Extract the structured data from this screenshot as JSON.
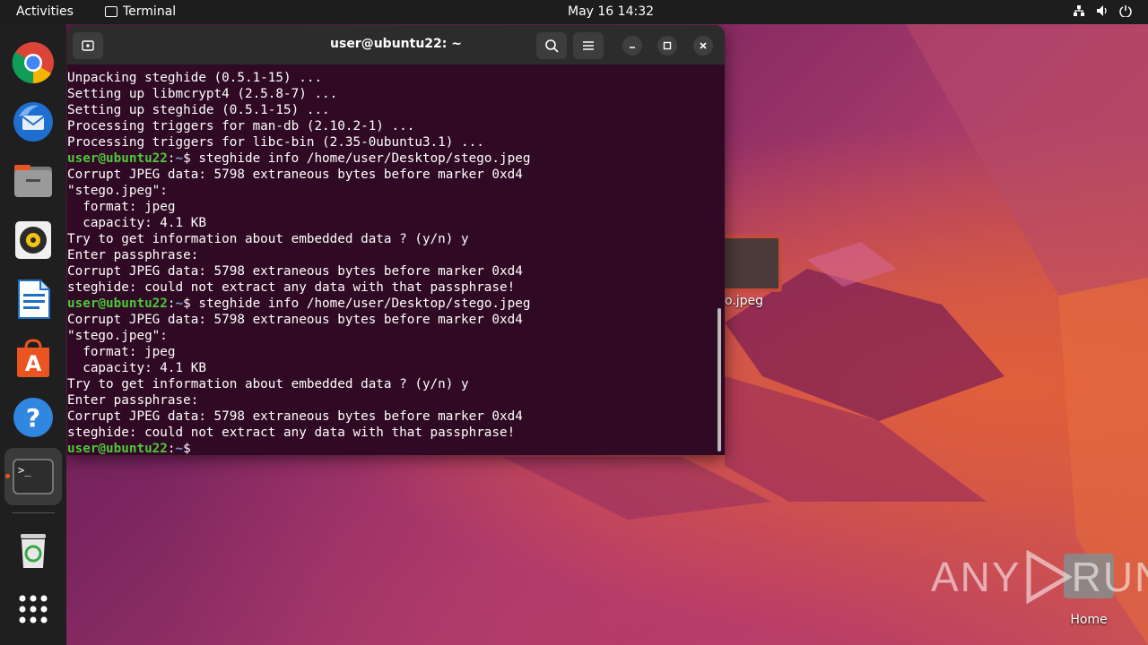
{
  "topbar": {
    "activities": "Activities",
    "app_name": "Terminal",
    "clock": "May 16  14:32",
    "tray_icons": [
      "network-icon",
      "volume-icon",
      "power-icon"
    ]
  },
  "dock": {
    "items": [
      "chrome",
      "thunderbird",
      "files",
      "rhythmbox",
      "libreoffice-writer",
      "app-center",
      "help",
      "terminal",
      "trash",
      "show-apps"
    ]
  },
  "terminal": {
    "title": "user@ubuntu22: ~",
    "prompt_user": "user@ubuntu22",
    "prompt_path": "~",
    "lines": [
      "Unpacking steghide (0.5.1-15) ...",
      "Setting up libmcrypt4 (2.5.8-7) ...",
      "Setting up steghide (0.5.1-15) ...",
      "Processing triggers for man-db (2.10.2-1) ...",
      "Processing triggers for libc-bin (2.35-0ubuntu3.1) ..."
    ],
    "command_1": "$ steghide info /home/user/Desktop/stego.jpeg",
    "output_1": [
      "Corrupt JPEG data: 5798 extraneous bytes before marker 0xd4",
      "\"stego.jpeg\":",
      "  format: jpeg",
      "  capacity: 4.1 KB",
      "Try to get information about embedded data ? (y/n) y",
      "Enter passphrase:",
      "Corrupt JPEG data: 5798 extraneous bytes before marker 0xd4",
      "steghide: could not extract any data with that passphrase!"
    ],
    "command_2": "$ steghide info /home/user/Desktop/stego.jpeg",
    "output_2": [
      "Corrupt JPEG data: 5798 extraneous bytes before marker 0xd4",
      "\"stego.jpeg\":",
      "  format: jpeg",
      "  capacity: 4.1 KB",
      "Try to get information about embedded data ? (y/n) y",
      "Enter passphrase:",
      "Corrupt JPEG data: 5798 extraneous bytes before marker 0xd4",
      "steghide: could not extract any data with that passphrase!"
    ],
    "final_prompt_symbol": "$"
  },
  "desktop": {
    "file_label": "o.jpeg",
    "home_label": "Home"
  },
  "watermark": {
    "text_left": "ANY",
    "text_right": "RUN"
  },
  "colors": {
    "terminal_bg": "#300a24",
    "prompt_user": "#4ec83a",
    "prompt_path": "#729fcf",
    "accent": "#e95420"
  }
}
